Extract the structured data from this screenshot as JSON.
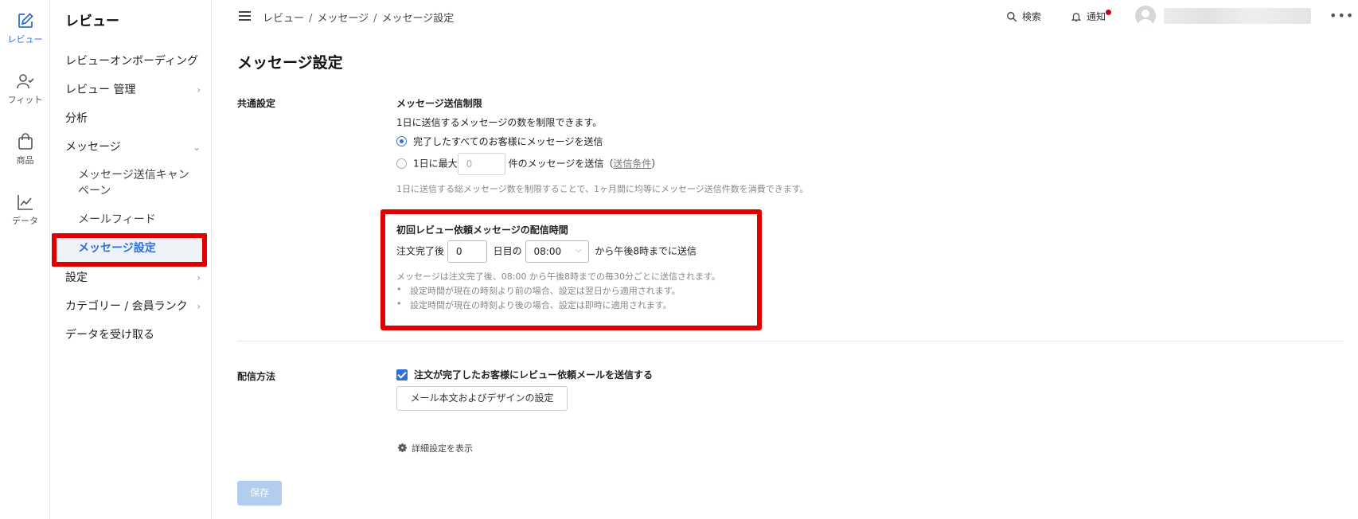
{
  "rail": {
    "items": [
      {
        "label": "レビュー",
        "icon": "edit-icon",
        "active": true
      },
      {
        "label": "フィット",
        "icon": "user-check-icon"
      },
      {
        "label": "商品",
        "icon": "bag-icon"
      },
      {
        "label": "データ",
        "icon": "chart-line-icon"
      }
    ]
  },
  "sidebar": {
    "title": "レビュー",
    "items": [
      {
        "label": "レビューオンボーディング"
      },
      {
        "label": "レビュー 管理"
      },
      {
        "label": "分析"
      },
      {
        "label": "メッセージ"
      },
      {
        "label": "メッセージ送信キャンペーン"
      },
      {
        "label": "メールフィード"
      },
      {
        "label": "メッセージ設定"
      },
      {
        "label": "設定"
      },
      {
        "label": "カテゴリー / 会員ランク"
      },
      {
        "label": "データを受け取る"
      }
    ]
  },
  "topbar": {
    "breadcrumb": [
      "レビュー",
      "メッセージ",
      "メッセージ設定"
    ],
    "separator": "/",
    "search_label": "検索",
    "notify_label": "通知",
    "more_label": "•••"
  },
  "page": {
    "title": "メッセージ設定",
    "common": {
      "section_label": "共通設定",
      "limit_title": "メッセージ送信制限",
      "limit_desc": "1日に送信するメッセージの数を制限できます。",
      "option_all": "完了したすべてのお客様にメッセージを送信",
      "option_max_prefix": "1日に最大",
      "option_max_value": "0",
      "option_max_suffix": "件のメッセージを送信（",
      "option_max_link": "送信条件",
      "option_max_close": "）",
      "limit_note": "1日に送信する総メッセージ数を制限することで、1ヶ月間に均等にメッセージ送信件数を消費できます。"
    },
    "first_review": {
      "title": "初回レビュー依頼メッセージの配信時間",
      "after_label": "注文完了後",
      "days_value": "0",
      "day_label": "日目の",
      "time_value": "08:00",
      "until_label": "から午後8時までに送信",
      "note": "メッセージは注文完了後、08:00 から午後8時までの毎30分ごとに送信されます。",
      "bullets": [
        "設定時間が現在の時刻より前の場合、設定は翌日から適用されます。",
        "設定時間が現在の時刻より後の場合、設定は即時に適用されます。"
      ]
    },
    "delivery": {
      "section_label": "配信方法",
      "checkbox_label": "注文が完了したお客様にレビュー依頼メールを送信する",
      "design_button": "メール本文およびデザインの設定",
      "advanced_label": "詳細設定を表示"
    },
    "save_label": "保存"
  },
  "colors": {
    "accent": "#2f6fd6",
    "highlight": "#e00000",
    "save_disabled": "#b3cdee"
  }
}
